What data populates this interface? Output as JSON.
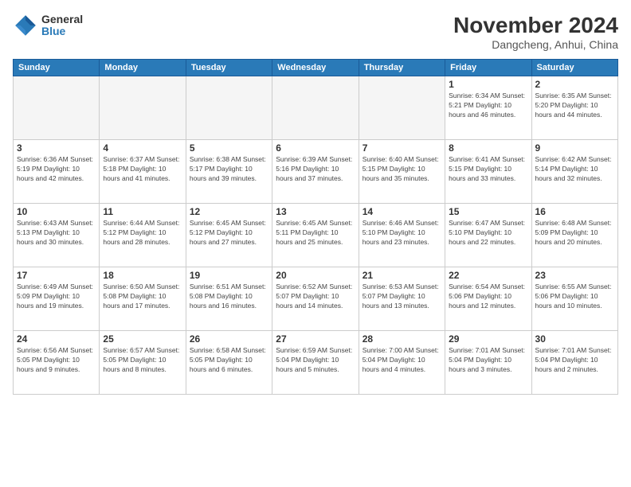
{
  "logo": {
    "general": "General",
    "blue": "Blue"
  },
  "title": "November 2024",
  "subtitle": "Dangcheng, Anhui, China",
  "days_header": [
    "Sunday",
    "Monday",
    "Tuesday",
    "Wednesday",
    "Thursday",
    "Friday",
    "Saturday"
  ],
  "weeks": [
    [
      {
        "day": "",
        "info": ""
      },
      {
        "day": "",
        "info": ""
      },
      {
        "day": "",
        "info": ""
      },
      {
        "day": "",
        "info": ""
      },
      {
        "day": "",
        "info": ""
      },
      {
        "day": "1",
        "info": "Sunrise: 6:34 AM\nSunset: 5:21 PM\nDaylight: 10 hours\nand 46 minutes."
      },
      {
        "day": "2",
        "info": "Sunrise: 6:35 AM\nSunset: 5:20 PM\nDaylight: 10 hours\nand 44 minutes."
      }
    ],
    [
      {
        "day": "3",
        "info": "Sunrise: 6:36 AM\nSunset: 5:19 PM\nDaylight: 10 hours\nand 42 minutes."
      },
      {
        "day": "4",
        "info": "Sunrise: 6:37 AM\nSunset: 5:18 PM\nDaylight: 10 hours\nand 41 minutes."
      },
      {
        "day": "5",
        "info": "Sunrise: 6:38 AM\nSunset: 5:17 PM\nDaylight: 10 hours\nand 39 minutes."
      },
      {
        "day": "6",
        "info": "Sunrise: 6:39 AM\nSunset: 5:16 PM\nDaylight: 10 hours\nand 37 minutes."
      },
      {
        "day": "7",
        "info": "Sunrise: 6:40 AM\nSunset: 5:15 PM\nDaylight: 10 hours\nand 35 minutes."
      },
      {
        "day": "8",
        "info": "Sunrise: 6:41 AM\nSunset: 5:15 PM\nDaylight: 10 hours\nand 33 minutes."
      },
      {
        "day": "9",
        "info": "Sunrise: 6:42 AM\nSunset: 5:14 PM\nDaylight: 10 hours\nand 32 minutes."
      }
    ],
    [
      {
        "day": "10",
        "info": "Sunrise: 6:43 AM\nSunset: 5:13 PM\nDaylight: 10 hours\nand 30 minutes."
      },
      {
        "day": "11",
        "info": "Sunrise: 6:44 AM\nSunset: 5:12 PM\nDaylight: 10 hours\nand 28 minutes."
      },
      {
        "day": "12",
        "info": "Sunrise: 6:45 AM\nSunset: 5:12 PM\nDaylight: 10 hours\nand 27 minutes."
      },
      {
        "day": "13",
        "info": "Sunrise: 6:45 AM\nSunset: 5:11 PM\nDaylight: 10 hours\nand 25 minutes."
      },
      {
        "day": "14",
        "info": "Sunrise: 6:46 AM\nSunset: 5:10 PM\nDaylight: 10 hours\nand 23 minutes."
      },
      {
        "day": "15",
        "info": "Sunrise: 6:47 AM\nSunset: 5:10 PM\nDaylight: 10 hours\nand 22 minutes."
      },
      {
        "day": "16",
        "info": "Sunrise: 6:48 AM\nSunset: 5:09 PM\nDaylight: 10 hours\nand 20 minutes."
      }
    ],
    [
      {
        "day": "17",
        "info": "Sunrise: 6:49 AM\nSunset: 5:09 PM\nDaylight: 10 hours\nand 19 minutes."
      },
      {
        "day": "18",
        "info": "Sunrise: 6:50 AM\nSunset: 5:08 PM\nDaylight: 10 hours\nand 17 minutes."
      },
      {
        "day": "19",
        "info": "Sunrise: 6:51 AM\nSunset: 5:08 PM\nDaylight: 10 hours\nand 16 minutes."
      },
      {
        "day": "20",
        "info": "Sunrise: 6:52 AM\nSunset: 5:07 PM\nDaylight: 10 hours\nand 14 minutes."
      },
      {
        "day": "21",
        "info": "Sunrise: 6:53 AM\nSunset: 5:07 PM\nDaylight: 10 hours\nand 13 minutes."
      },
      {
        "day": "22",
        "info": "Sunrise: 6:54 AM\nSunset: 5:06 PM\nDaylight: 10 hours\nand 12 minutes."
      },
      {
        "day": "23",
        "info": "Sunrise: 6:55 AM\nSunset: 5:06 PM\nDaylight: 10 hours\nand 10 minutes."
      }
    ],
    [
      {
        "day": "24",
        "info": "Sunrise: 6:56 AM\nSunset: 5:05 PM\nDaylight: 10 hours\nand 9 minutes."
      },
      {
        "day": "25",
        "info": "Sunrise: 6:57 AM\nSunset: 5:05 PM\nDaylight: 10 hours\nand 8 minutes."
      },
      {
        "day": "26",
        "info": "Sunrise: 6:58 AM\nSunset: 5:05 PM\nDaylight: 10 hours\nand 6 minutes."
      },
      {
        "day": "27",
        "info": "Sunrise: 6:59 AM\nSunset: 5:04 PM\nDaylight: 10 hours\nand 5 minutes."
      },
      {
        "day": "28",
        "info": "Sunrise: 7:00 AM\nSunset: 5:04 PM\nDaylight: 10 hours\nand 4 minutes."
      },
      {
        "day": "29",
        "info": "Sunrise: 7:01 AM\nSunset: 5:04 PM\nDaylight: 10 hours\nand 3 minutes."
      },
      {
        "day": "30",
        "info": "Sunrise: 7:01 AM\nSunset: 5:04 PM\nDaylight: 10 hours\nand 2 minutes."
      }
    ]
  ]
}
